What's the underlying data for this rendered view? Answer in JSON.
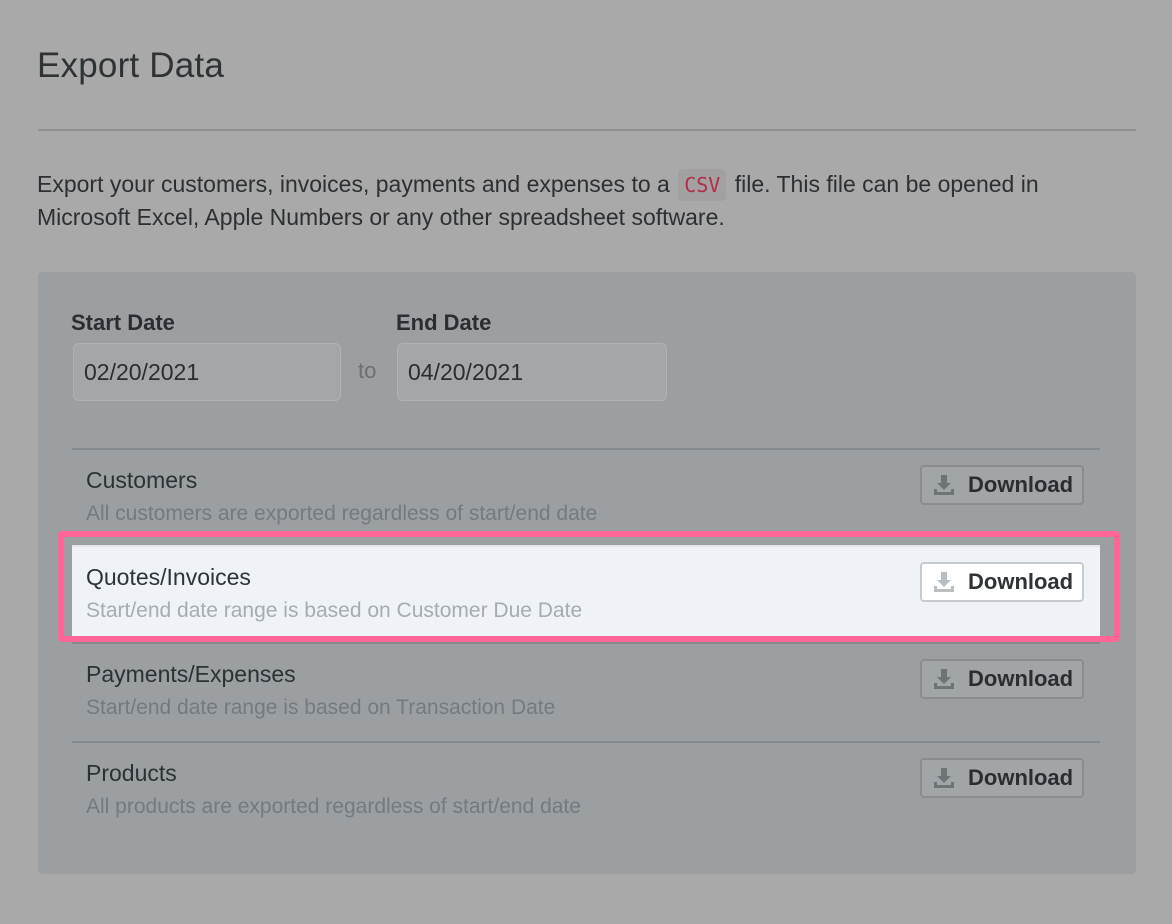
{
  "page": {
    "title": "Export Data",
    "intro_before": "Export your customers, invoices, payments and expenses to a ",
    "intro_code": "CSV",
    "intro_after": " file. This file can be opened in Microsoft Excel, Apple Numbers or any other spreadsheet software."
  },
  "dates": {
    "start_label": "Start Date",
    "start_value": "02/20/2021",
    "to_label": "to",
    "end_label": "End Date",
    "end_value": "04/20/2021"
  },
  "exports": [
    {
      "title": "Customers",
      "description": "All customers are exported regardless of start/end date",
      "button": "Download",
      "highlighted": false
    },
    {
      "title": "Quotes/Invoices",
      "description": "Start/end date range is based on Customer Due Date",
      "button": "Download",
      "highlighted": true
    },
    {
      "title": "Payments/Expenses",
      "description": "Start/end date range is based on Transaction Date",
      "button": "Download",
      "highlighted": false
    },
    {
      "title": "Products",
      "description": "All products are exported regardless of start/end date",
      "button": "Download",
      "highlighted": false
    }
  ],
  "icons": {
    "download": "download-icon"
  },
  "colors": {
    "highlight_border": "#ff6596",
    "code_text": "#b12f4a"
  }
}
